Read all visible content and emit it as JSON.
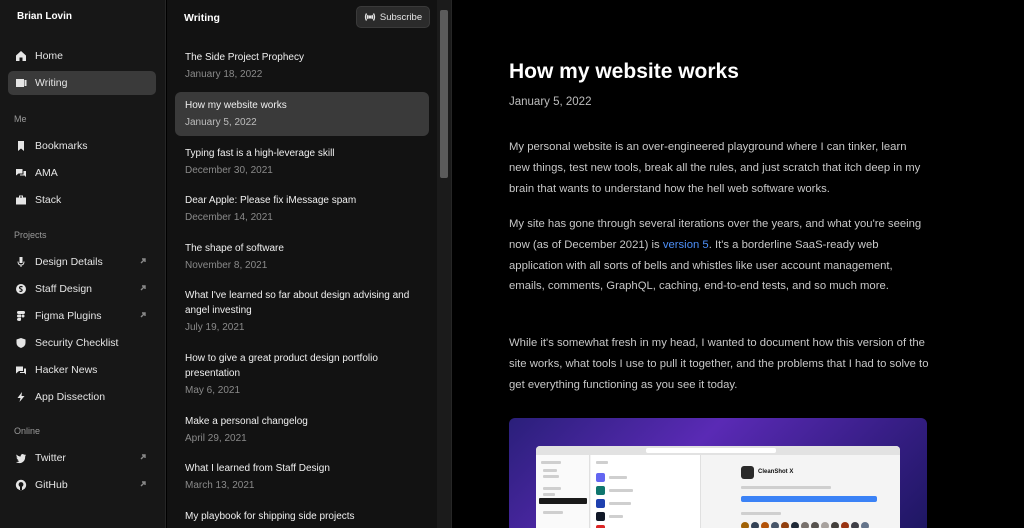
{
  "sidebar": {
    "brand": "Brian Lovin",
    "primary": [
      {
        "label": "Home",
        "icon": "home-icon",
        "active": false
      },
      {
        "label": "Writing",
        "icon": "writing-icon",
        "active": true
      }
    ],
    "sections": [
      {
        "label": "Me",
        "items": [
          {
            "label": "Bookmarks",
            "icon": "bookmark-icon"
          },
          {
            "label": "AMA",
            "icon": "chat-icon"
          },
          {
            "label": "Stack",
            "icon": "stack-icon"
          }
        ]
      },
      {
        "label": "Projects",
        "items": [
          {
            "label": "Design Details",
            "icon": "microphone-icon",
            "external": true
          },
          {
            "label": "Staff Design",
            "icon": "staff-design-icon",
            "external": true
          },
          {
            "label": "Figma Plugins",
            "icon": "figma-icon",
            "external": true
          },
          {
            "label": "Security Checklist",
            "icon": "shield-icon",
            "external": false
          },
          {
            "label": "Hacker News",
            "icon": "news-icon",
            "external": false
          },
          {
            "label": "App Dissection",
            "icon": "bolt-icon",
            "external": false
          }
        ]
      },
      {
        "label": "Online",
        "items": [
          {
            "label": "Twitter",
            "icon": "twitter-icon",
            "external": true
          },
          {
            "label": "GitHub",
            "icon": "github-icon",
            "external": true
          }
        ]
      }
    ]
  },
  "list": {
    "title": "Writing",
    "subscribe_label": "Subscribe",
    "posts": [
      {
        "title": "The Side Project Prophecy",
        "date": "January 18, 2022"
      },
      {
        "title": "How my website works",
        "date": "January 5, 2022",
        "active": true
      },
      {
        "title": "Typing fast is a high-leverage skill",
        "date": "December 30, 2021"
      },
      {
        "title": "Dear Apple: Please fix iMessage spam",
        "date": "December 14, 2021"
      },
      {
        "title": "The shape of software",
        "date": "November 8, 2021"
      },
      {
        "title": "What I've learned so far about design advising and angel investing",
        "date": "July 19, 2021"
      },
      {
        "title": "How to give a great product design portfolio presentation",
        "date": "May 6, 2021"
      },
      {
        "title": "Make a personal changelog",
        "date": "April 29, 2021"
      },
      {
        "title": "What I learned from Staff Design",
        "date": "March 13, 2021"
      },
      {
        "title": "My playbook for shipping side projects",
        "date": ""
      }
    ]
  },
  "article": {
    "title": "How my website works",
    "date": "January 5, 2022",
    "p1": "My personal website is an over-engineered playground where I can tinker, learn new things, test new tools, break all the rules, and just scratch that itch deep in my brain that wants to understand how the hell web software works.",
    "p2_before": "My site has gone through several iterations over the years, and what you're seeing now (as of December 2021) is ",
    "p2_link": "version 5",
    "p2_after": ". It's a borderline SaaS-ready web application with all sorts of bells and whistles like user account management, emails, comments, GraphQL, caching, end-to-end tests, and so much more.",
    "p3": "While it's somewhat fresh in my head, I wanted to document how this version of the site works, what tools I use to pull it together, and the problems that I had to solve to get everything functioning as you see it today.",
    "hero_app_title": "CleanShot X",
    "link_color": "#4d8ff7"
  }
}
